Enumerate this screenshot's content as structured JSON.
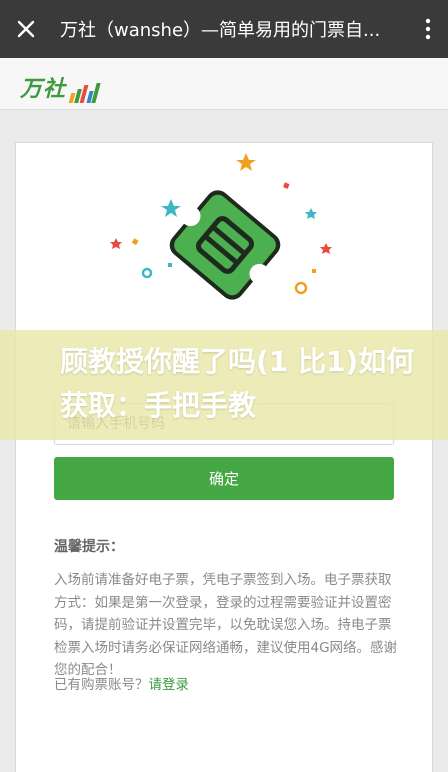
{
  "topbar": {
    "title": "万社（wanshe）—简单易用的门票自..."
  },
  "site": {
    "logo_text": "万社"
  },
  "form": {
    "input_placeholder": "请输入手机号码",
    "confirm_label": "确定"
  },
  "tips": {
    "title": "温馨提示：",
    "body": "入场前请准备好电子票，凭电子票签到入场。电子票获取方式：如果是第一次登录，登录的过程需要验证并设置密码，请提前验证并设置完毕，以免耽误您入场。持电子票检票入场时请务必保证网络通畅，建议使用4G网络。感谢您的配合！"
  },
  "login": {
    "prefix": "已有购票账号？",
    "link": "请登录"
  },
  "banner": {
    "text": "顾教授你醒了吗(1 比1)如何获取：手把手教"
  },
  "colors": {
    "brand_green": "#45a845",
    "topbar": "#3a3a3a"
  },
  "icons": {
    "close": "close-icon",
    "more": "more-vertical-icon",
    "ticket": "ticket-icon"
  }
}
